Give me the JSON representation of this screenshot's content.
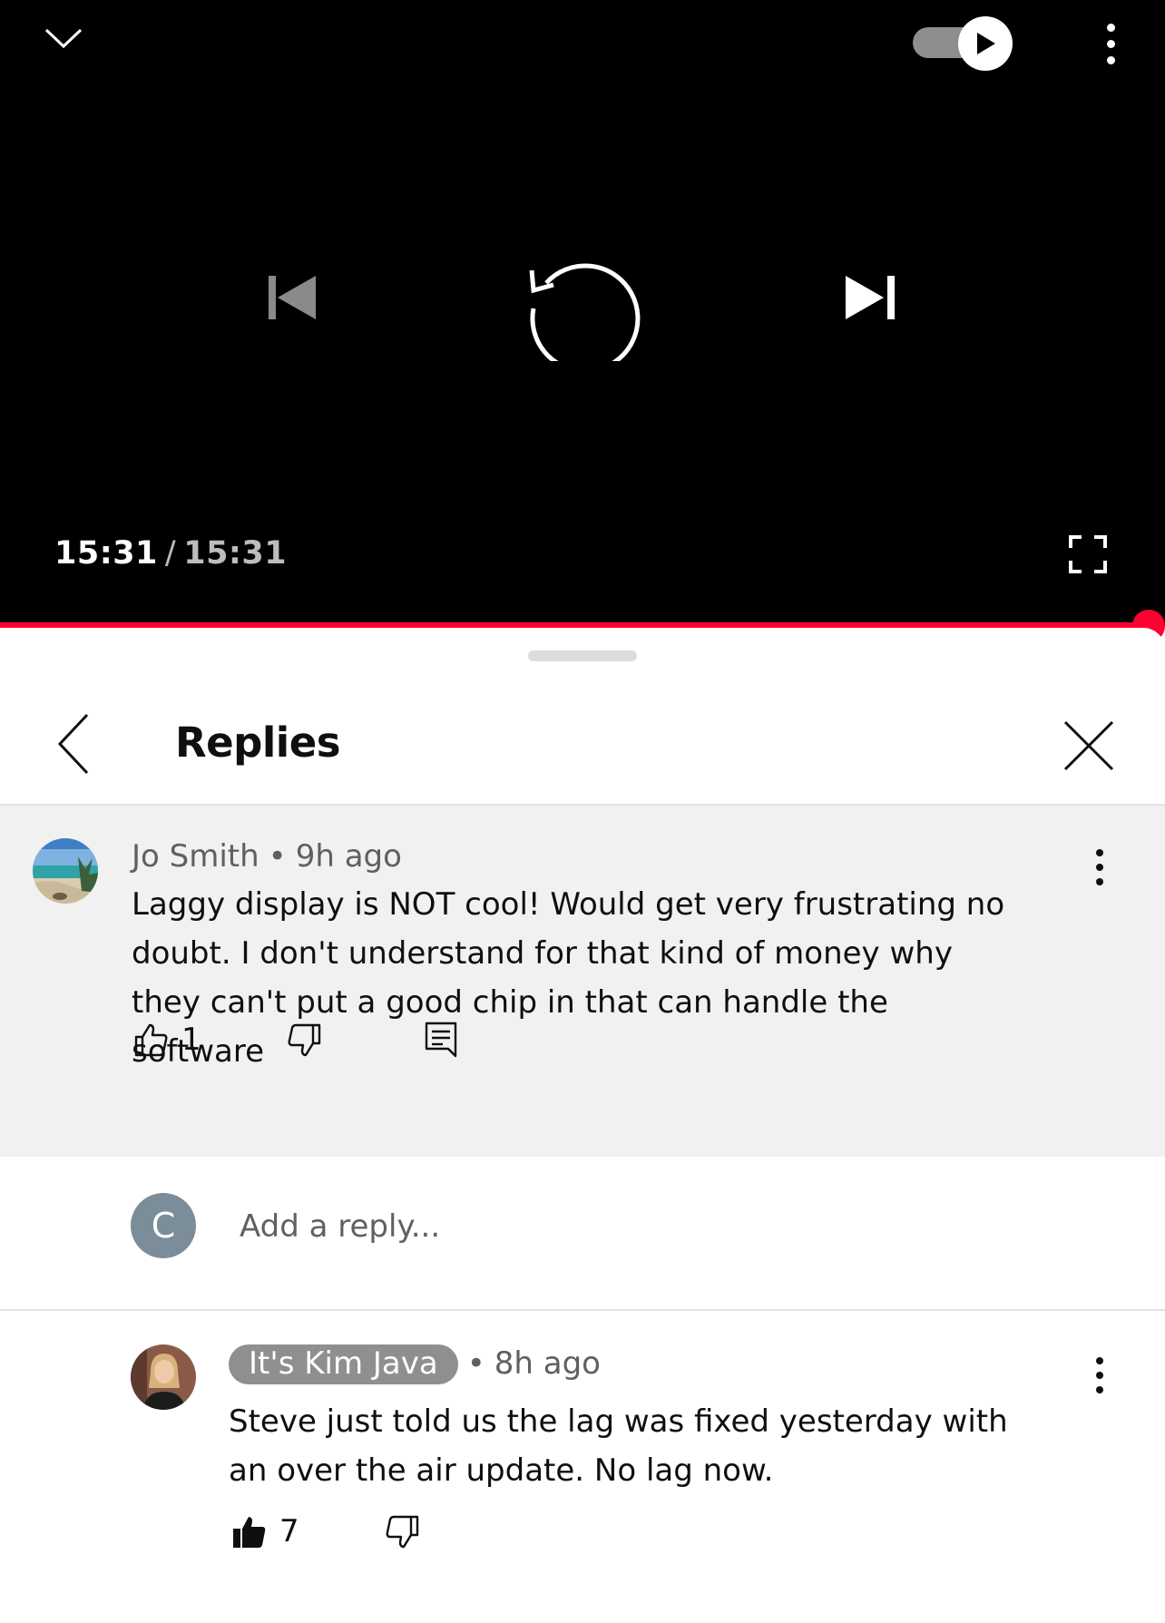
{
  "player": {
    "current_time": "15:31",
    "separator": "/",
    "total_time": "15:31",
    "progress_percent": 100,
    "accent_color": "#ff0033"
  },
  "sheet": {
    "title": "Replies"
  },
  "parent_comment": {
    "author": "Jo Smith",
    "dot": "•",
    "time": "9h ago",
    "text": "Laggy display is NOT cool!  Would get very frustrating no doubt. I don't understand for that kind of money why they can't put a good chip in that can handle the software",
    "likes": "1"
  },
  "reply_box": {
    "avatar_letter": "C",
    "placeholder": "Add a reply..."
  },
  "reply": {
    "author": "It's Kim Java",
    "dot": "•",
    "time": "8h ago",
    "text": "Steve just told us the lag was fixed yesterday with an over the air update. No lag now.",
    "likes": "7"
  }
}
